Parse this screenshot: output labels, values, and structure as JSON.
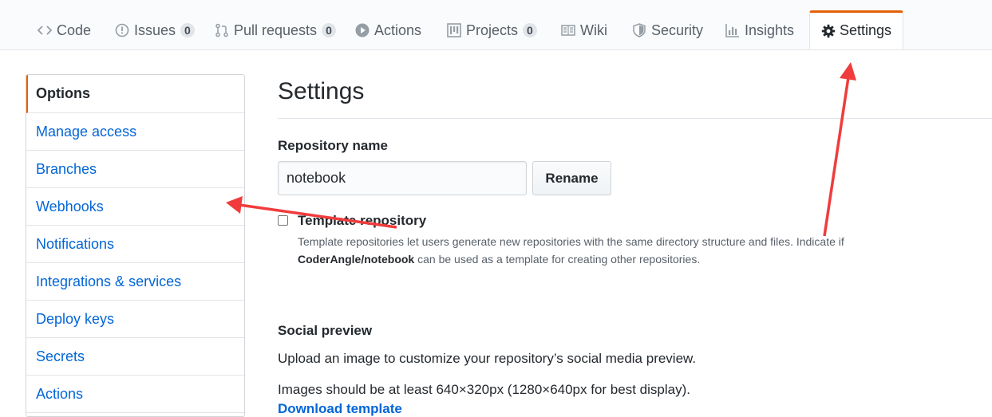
{
  "nav": {
    "tabs": [
      {
        "label": "Code",
        "icon": "code-icon"
      },
      {
        "label": "Issues",
        "count": "0",
        "icon": "issue-icon"
      },
      {
        "label": "Pull requests",
        "count": "0",
        "icon": "pull-request-icon"
      },
      {
        "label": "Actions",
        "icon": "play-icon"
      },
      {
        "label": "Projects",
        "count": "0",
        "icon": "project-icon"
      },
      {
        "label": "Wiki",
        "icon": "book-icon"
      },
      {
        "label": "Security",
        "icon": "shield-icon"
      },
      {
        "label": "Insights",
        "icon": "graph-icon"
      },
      {
        "label": "Settings",
        "icon": "gear-icon",
        "selected": true
      }
    ]
  },
  "sidebar": {
    "items": [
      {
        "label": "Options",
        "selected": true
      },
      {
        "label": "Manage access"
      },
      {
        "label": "Branches"
      },
      {
        "label": "Webhooks"
      },
      {
        "label": "Notifications"
      },
      {
        "label": "Integrations & services"
      },
      {
        "label": "Deploy keys"
      },
      {
        "label": "Secrets"
      },
      {
        "label": "Actions"
      }
    ]
  },
  "main": {
    "title": "Settings",
    "repo_name_label": "Repository name",
    "repo_name_value": "notebook",
    "rename_label": "Rename",
    "template_label": "Template repository",
    "template_note_1": "Template repositories let users generate new repositories with the same directory structure and files. Indicate if",
    "template_note_repo": "CoderAngle/notebook",
    "template_note_2": " can be used as a template for creating other repositories.",
    "social_heading": "Social preview",
    "social_desc_1": "Upload an image to customize your repository’s social media preview.",
    "social_desc_2": "Images should be at least 640×320px (1280×640px for best display).",
    "download_link": "Download template"
  },
  "colors": {
    "accent_orange": "#e36209",
    "link_blue": "#0366d6",
    "annotation_red": "#f03c3c"
  }
}
